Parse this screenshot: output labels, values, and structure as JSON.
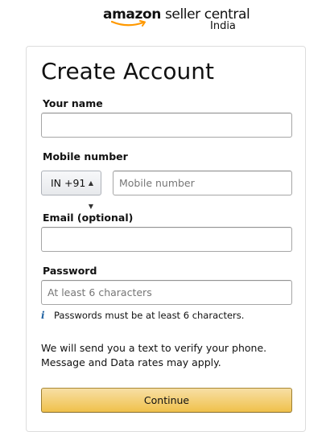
{
  "brand": {
    "logo_amazon": "amazon",
    "logo_rest": " seller central",
    "logo_region": "India",
    "smile_color": "#ff9900"
  },
  "form": {
    "title": "Create Account",
    "name_label": "Your name",
    "name_value": "",
    "mobile_label": "Mobile number",
    "country_code": "IN +91",
    "mobile_placeholder": "Mobile number",
    "email_label": "Email (optional)",
    "email_value": "",
    "password_label": "Password",
    "password_placeholder": "At least 6 characters",
    "password_hint": "Passwords must be at least 6 characters.",
    "notice_line1": "We will send you a text to verify your phone.",
    "notice_line2": "Message and Data rates may apply.",
    "continue_label": "Continue"
  },
  "icons": {
    "info": "info-icon",
    "caret": "updown-caret-icon"
  },
  "colors": {
    "button_top": "#f7dfa5",
    "button_bottom": "#f0c14b",
    "info_icon": "#2162a1"
  }
}
